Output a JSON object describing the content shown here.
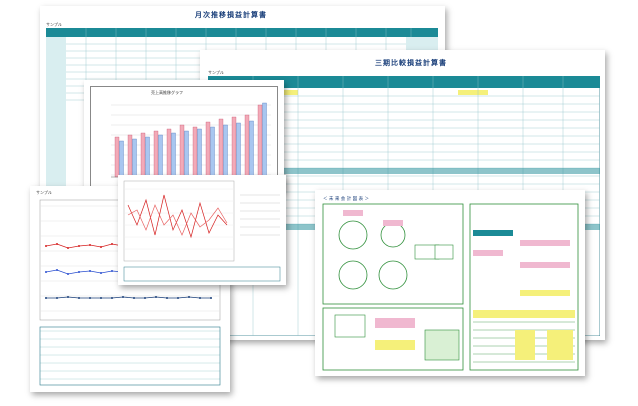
{
  "sheet_monthly": {
    "title": "月次推移損益計算書",
    "label": "サンプル"
  },
  "sheet_compare": {
    "title": "三期比較損益計算書",
    "label": "サンプル"
  },
  "sheet_bar": {
    "title": "売上高推移グラフ"
  },
  "sheet_line": {
    "label": "サンプル"
  },
  "sheet_plan": {
    "title": "＜ 未 来 会 計 図 表 ＞"
  },
  "colors": {
    "teal": "#1b8a96",
    "navy": "#1a3f7a",
    "green": "#2f8f3a",
    "red": "#d62020",
    "yellow": "#f5f07a",
    "pink": "#f0b8d0"
  }
}
